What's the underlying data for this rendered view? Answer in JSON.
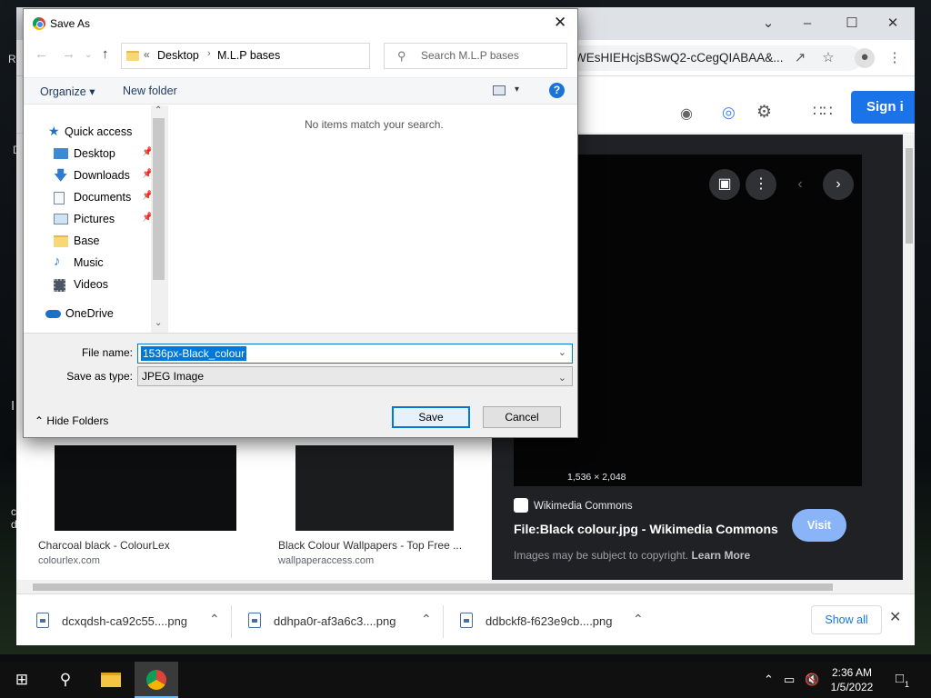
{
  "desktop": {
    "fragments": [
      "R",
      "D",
      "I",
      "c",
      "d"
    ]
  },
  "browser": {
    "omnibox_text": "WEsHIEHcjsBSwQ2-cCegQIABAA&...",
    "signin_label": "Sign i",
    "results": [
      {
        "title": "Charcoal black - ColourLex",
        "source": "colourlex.com"
      },
      {
        "title": "Black Colour Wallpapers - Top Free ...",
        "source": "wallpaperaccess.com"
      }
    ],
    "preview": {
      "dimensions": "1,536 × 2,048",
      "source": "Wikimedia Commons",
      "title": "File:Black colour.jpg - Wikimedia Commons",
      "visit_label": "Visit",
      "copyright_text": "Images may be subject to copyright.",
      "learn_more": "Learn More"
    },
    "downloads": [
      {
        "name": "dcxqdsh-ca92c55....png"
      },
      {
        "name": "ddhpa0r-af3a6c3....png"
      },
      {
        "name": "ddbckf8-f623e9cb....png"
      }
    ],
    "show_all_label": "Show all"
  },
  "dialog": {
    "title": "Save As",
    "path": {
      "overflow": "«",
      "parts": [
        "Desktop",
        "M.L.P bases"
      ]
    },
    "search_placeholder": "Search M.L.P bases",
    "organize_label": "Organize",
    "new_folder_label": "New folder",
    "empty_message": "No items match your search.",
    "nav": {
      "quick_access": "Quick access",
      "items": [
        {
          "label": "Desktop",
          "pinned": true,
          "icon": "desktop-icon"
        },
        {
          "label": "Downloads",
          "pinned": true,
          "icon": "download-arrow-icon"
        },
        {
          "label": "Documents",
          "pinned": true,
          "icon": "documents-icon"
        },
        {
          "label": "Pictures",
          "pinned": true,
          "icon": "pictures-icon"
        },
        {
          "label": "Base",
          "pinned": false,
          "icon": "folder-icon"
        },
        {
          "label": "Music",
          "pinned": false,
          "icon": "music-note-icon"
        },
        {
          "label": "Videos",
          "pinned": false,
          "icon": "film-icon"
        }
      ],
      "onedrive": "OneDrive"
    },
    "file_name_label": "File name:",
    "file_name_value": "1536px-Black_colour",
    "save_type_label": "Save as type:",
    "save_type_value": "JPEG Image",
    "hide_folders_label": "Hide Folders",
    "save_label": "Save",
    "cancel_label": "Cancel"
  },
  "taskbar": {
    "time": "2:36 AM",
    "date": "1/5/2022",
    "notification_count": "1"
  },
  "colors": {
    "accent": "#0078d7",
    "google_blue": "#1a73e8",
    "visit_blue": "#8ab4f8"
  }
}
